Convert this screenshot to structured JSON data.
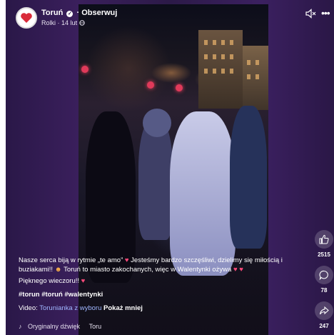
{
  "header": {
    "page_name": "Toruń",
    "follow_label": "Obserwuj",
    "separator": "·",
    "sub_section": "Rolki",
    "date": "14 lut",
    "verified_glyph": "✓"
  },
  "actions": {
    "likes": "2515",
    "comments": "78",
    "shares": "247"
  },
  "caption": {
    "line1_a": "Nasze serca biją w rytmie „te amo”",
    "line1_b": "Jesteśmy bardzo szczęśliwi, dzielimy się miłością i buziakami!!",
    "line1_c": "Toruń to miasto zakochanych, więc w Walentynki ożywa",
    "line2": "Pięknego wieczoru!!",
    "hashtags": "#torun #toruń #walentynki",
    "video_prefix": "Video:",
    "video_credit": "Torunianka z wyboru",
    "show_more": "Pokaż mniej"
  },
  "audio": {
    "label": "Oryginalny dźwięk",
    "track": "Toru"
  },
  "icons": {
    "heart": "heart-icon",
    "kiss_face": "kissing-face-icon",
    "mute": "speaker-muted-icon",
    "more": "more-dots-icon",
    "like": "thumbs-up-icon",
    "comment": "comment-bubble-icon",
    "share": "share-arrow-icon",
    "music": "music-note-icon"
  },
  "colors": {
    "background": "#2a1848",
    "link": "#9fb6ff",
    "heart": "#ff4a7a"
  }
}
